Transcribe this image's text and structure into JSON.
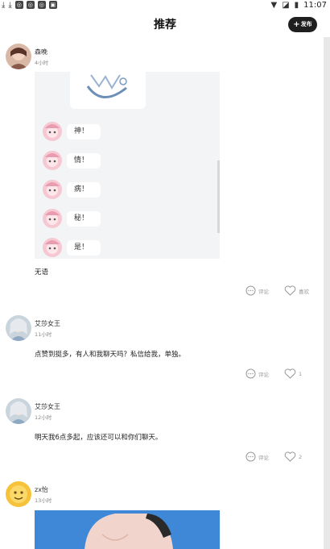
{
  "status_bar": {
    "time": "11:07"
  },
  "header": {
    "title": "推荐",
    "publish_label": "发布"
  },
  "posts": [
    {
      "username": "森晚",
      "time": "4小时",
      "chat_bubbles": [
        "神！",
        "情！",
        "病！",
        "秘！",
        "是！"
      ],
      "text": "无语",
      "comment_label": "评论",
      "like_label": "喜欢"
    },
    {
      "username": "艾莎女王",
      "time": "11小时",
      "text": "点赞到挺多，有人和我聊天吗？私信给我，单独。",
      "comment_label": "评论",
      "like_label": "1"
    },
    {
      "username": "艾莎女王",
      "time": "12小时",
      "text": "明天我6点多起，应该还可以和你们聊天。",
      "comment_label": "评论",
      "like_label": "2"
    },
    {
      "username": "zx怡",
      "time": "13小时"
    }
  ]
}
